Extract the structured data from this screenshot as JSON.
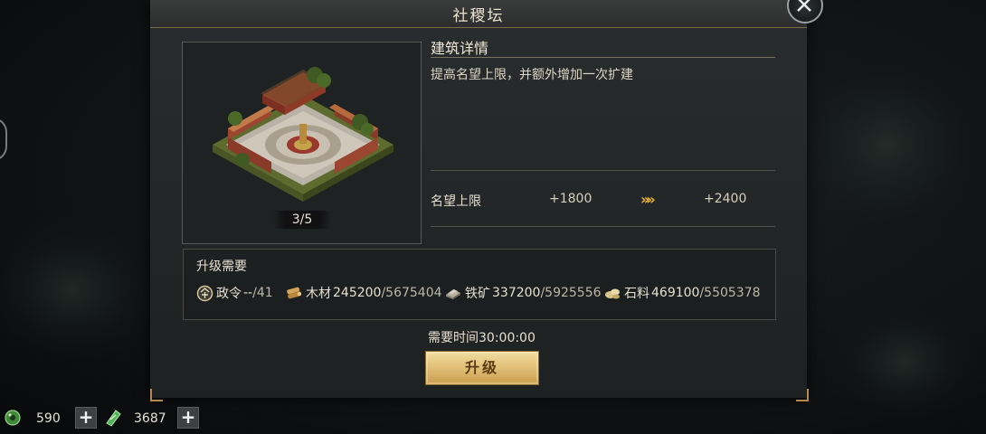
{
  "dialog": {
    "title": "社稷坛",
    "level": "3/5",
    "details_title": "建筑详情",
    "description": "提高名望上限，并额外增加一次扩建",
    "stat": {
      "label": "名望上限",
      "current": "+1800",
      "arrow": "»»",
      "next": "+2400"
    },
    "requirements": {
      "title": "升级需要",
      "items": [
        {
          "icon": "order-token-icon",
          "name": "政令",
          "have": "--",
          "need": "/41"
        },
        {
          "icon": "wood-icon",
          "name": "木材",
          "have": "245200",
          "need": "/5675404"
        },
        {
          "icon": "iron-ore-icon",
          "name": "铁矿",
          "have": "337200",
          "need": "/5925556"
        },
        {
          "icon": "stone-icon",
          "name": "石料",
          "have": "469100",
          "need": "/5505378"
        }
      ]
    },
    "time_label": "需要时间30:00:00",
    "upgrade_label": "升级"
  },
  "resources": [
    {
      "icon": "jade-coin-icon",
      "value": "590"
    },
    {
      "icon": "green-ticket-icon",
      "value": "3687"
    }
  ],
  "colors": {
    "accent_gold": "#e3c27a",
    "arrow": "#e7b23e",
    "panel": "#232627"
  }
}
